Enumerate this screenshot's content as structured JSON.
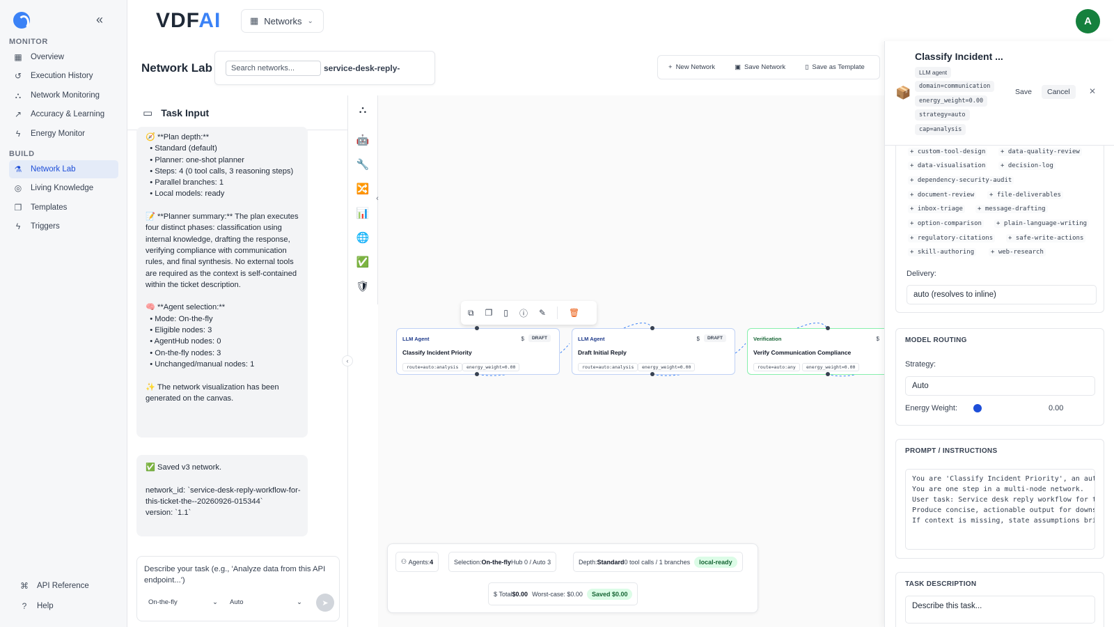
{
  "sidebar": {
    "sections": [
      {
        "label": "MONITOR"
      },
      {
        "label": "BUILD"
      }
    ],
    "items": [
      {
        "label": "Overview",
        "icon": "grid-icon"
      },
      {
        "label": "Execution History",
        "icon": "history-icon"
      },
      {
        "label": "Network Monitoring",
        "icon": "network-icon"
      },
      {
        "label": "Accuracy & Learning",
        "icon": "trend-icon"
      },
      {
        "label": "Energy Monitor",
        "icon": "bolt-icon"
      },
      {
        "label": "Network Lab",
        "icon": "flask-icon",
        "active": true
      },
      {
        "label": "Living Knowledge",
        "icon": "brain-icon"
      },
      {
        "label": "Templates",
        "icon": "copy-icon"
      },
      {
        "label": "Triggers",
        "icon": "bolt-icon"
      }
    ],
    "footer": [
      {
        "label": "API Reference",
        "icon": "code-icon"
      },
      {
        "label": "Help",
        "icon": "help-icon"
      }
    ]
  },
  "header": {
    "brand": "VDFAI",
    "brand_left": "VDF",
    "brand_right": "AI",
    "networks_label": "Networks",
    "avatar_letter": "A"
  },
  "lab": {
    "title": "Network Lab",
    "search_placeholder": "Search networks...",
    "current_network": "service-desk-reply-",
    "actions": {
      "new": "New Network",
      "save": "Save Network",
      "template": "Save as Template"
    }
  },
  "task": {
    "title": "Task Input",
    "message1": "🧭 **Plan depth:**\n  • Standard (default)\n  • Planner: one-shot planner\n  • Steps: 4 (0 tool calls, 3 reasoning steps)\n  • Parallel branches: 1\n  • Local models: ready\n\n📝 **Planner summary:** The plan executes four distinct phases: classification using internal knowledge, drafting the response, verifying compliance with communication rules, and final synthesis. No external tools are required as the context is self-contained within the ticket description.\n\n🧠 **Agent selection:**\n  • Mode: On-the-fly\n  • Eligible nodes: 3\n  • AgentHub nodes: 0\n  • On-the-fly nodes: 3\n  • Unchanged/manual nodes: 1\n\n✨ The network visualization has been generated on the canvas.",
    "message2": "✅ Saved v3 network.\n\nnetwork_id: `service-desk-reply-workflow-for-this-ticket-the--20260926-015344`\nversion: `1.1`",
    "composer_placeholder": "Describe your task (e.g., 'Analyze data from this API endpoint...')",
    "mode": "On-the-fly",
    "routing": "Auto"
  },
  "nodes": [
    {
      "type": "LLM Agent",
      "title": "Classify Incident Priority",
      "cost": "$",
      "status": "DRAFT",
      "route": "route=auto:analysis",
      "energy": "energy_weight=0.00"
    },
    {
      "type": "LLM Agent",
      "title": "Draft Initial Reply",
      "cost": "$",
      "status": "DRAFT",
      "route": "route=auto:analysis",
      "energy": "energy_weight=0.00"
    },
    {
      "type": "Verification",
      "title": "Verify Communication Compliance",
      "cost": "$",
      "status": "",
      "route": "route=auto:any",
      "energy": "energy_weight=0.00"
    }
  ],
  "stats": {
    "agents_label": "Agents:",
    "agents_value": "4",
    "selection_label": "Selection:",
    "selection_value": "On-the-fly",
    "selection_rest": "Hub 0 / Auto 3",
    "depth_label": "Depth:",
    "depth_value": "Standard",
    "depth_rest": "0 tool calls / 1 branches",
    "local_badge": "local-ready",
    "total_label": "Total",
    "total_value": "$0.00",
    "worst_case": "Worst-case: $0.00",
    "saved_badge": "Saved $0.00"
  },
  "detail": {
    "name": "Classify Incident ...",
    "chips": [
      "LLM agent",
      "domain=communication",
      "energy_weight=0.00",
      "strategy=auto",
      "cap=analysis"
    ],
    "save": "Save",
    "cancel": "Cancel",
    "skills": [
      "custom-tool-design",
      "data-quality-review",
      "data-visualisation",
      "decision-log",
      "dependency-security-audit",
      "document-review",
      "file-deliverables",
      "inbox-triage",
      "message-drafting",
      "option-comparison",
      "plain-language-writing",
      "regulatory-citations",
      "safe-write-actions",
      "skill-authoring",
      "web-research"
    ],
    "delivery_label": "Delivery:",
    "delivery_value": "auto (resolves to inline)",
    "routing_title": "MODEL ROUTING",
    "strategy_label": "Strategy:",
    "strategy_value": "Auto",
    "energy_label": "Energy Weight:",
    "energy_value": "0.00",
    "prompt_title": "PROMPT / INSTRUCTIONS",
    "prompt_text": "You are 'Classify Incident Priority', an aut\nYou are one step in a multi-node network.\nUser task: Service desk reply workflow for t\nProduce concise, actionable output for downs\nIf context is missing, state assumptions bri",
    "taskdesc_title": "TASK DESCRIPTION",
    "taskdesc_placeholder": "Describe this task..."
  }
}
